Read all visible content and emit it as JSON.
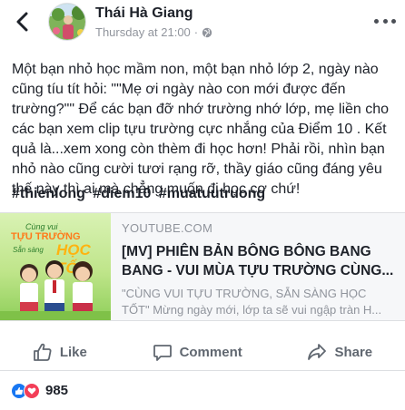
{
  "header": {
    "author": "Thái Hà Giang",
    "timestamp": "Thursday at 21:00",
    "separator": "·",
    "privacy_icon": "globe-icon",
    "more_icon": "more-icon",
    "back_icon": "back-chevron-icon"
  },
  "post": {
    "text": "Một bạn nhỏ học mầm non, một bạn nhỏ lớp 2, ngày nào cũng tíu tít hỏi: \"\"Mẹ ơi ngày nào con mới được đến trường?\"\" Để các bạn đỡ nhớ trường nhớ lớp, mẹ liền cho các bạn xem clip tựu trường cực nhắng của Điểm 10 . Kết quả là...xem xong còn thèm đi học hơn! Phải rồi, nhìn bạn nhỏ nào cũng cười tươi rạng rỡ, thầy giáo cũng đáng yêu thế này thì ai mà chẳng muốn đi học cơ chứ!",
    "hashtags": [
      "#thienlong",
      "#diem10",
      "#muatuutruong"
    ]
  },
  "link_card": {
    "domain": "YOUTUBE.COM",
    "title": "[MV] PHIÊN BẢN BÔNG BÔNG BANG BANG - VUI MÙA TỰU TRƯỜNG CÙNG...",
    "description": "\"CÙNG VUI TỰU TRƯỜNG, SẴN SÀNG HỌC TỐT\" Mừng ngày mới, lớp ta sẽ vui ngập tràn H...",
    "thumbnail": {
      "line1": "Cùng vui",
      "line2": "TỰU TRƯỜNG",
      "line3": "Sẵn sàng",
      "line4": "HỌC TỐT"
    }
  },
  "actions": {
    "like": "Like",
    "comment": "Comment",
    "share": "Share"
  },
  "reactions": {
    "count": "985",
    "icons": [
      "like-icon",
      "love-icon"
    ]
  },
  "colors": {
    "text": "#1d2129",
    "secondary": "#90949c",
    "action": "#606770",
    "like_blue": "#1877f2",
    "love_red": "#f33e58",
    "card_bg": "#f6f7f9"
  }
}
